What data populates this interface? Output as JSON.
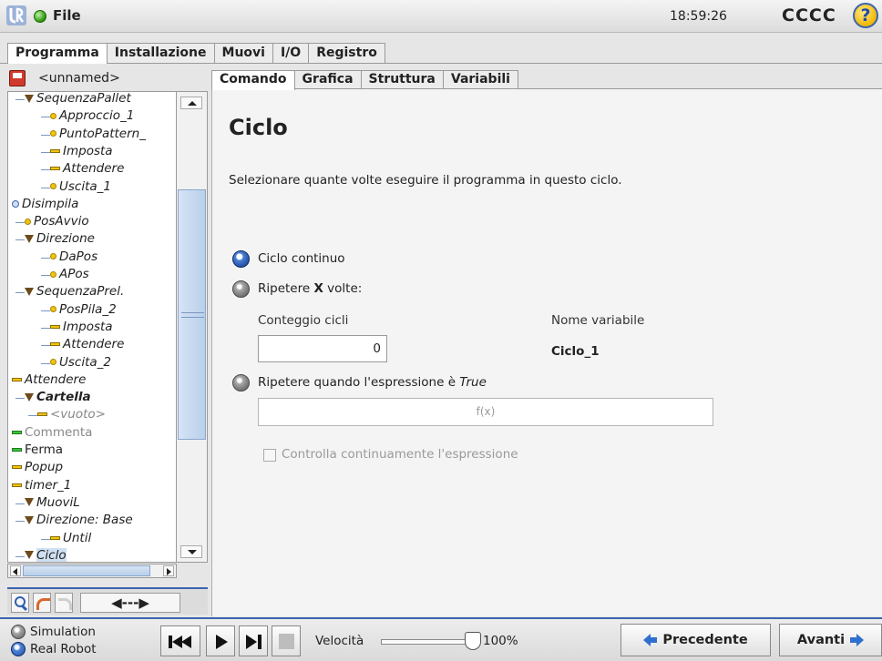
{
  "topbar": {
    "file_label": "File",
    "clock": "18:59:26",
    "robot_name": "CCCC",
    "help_label": "?"
  },
  "main_tabs": [
    {
      "label": "Programma",
      "active": true
    },
    {
      "label": "Installazione",
      "active": false
    },
    {
      "label": "Muovi",
      "active": false
    },
    {
      "label": "I/O",
      "active": false
    },
    {
      "label": "Registro",
      "active": false
    }
  ],
  "program": {
    "name": "<unnamed>"
  },
  "tree": [
    {
      "label": "SequenzaPallet",
      "icon": "folder-icon",
      "style": "italic"
    },
    {
      "label": "Approccio_1",
      "icon": "waypoint-icon",
      "style": "italic"
    },
    {
      "label": "PuntoPattern_",
      "icon": "waypoint-icon",
      "style": "italic"
    },
    {
      "label": "Imposta",
      "icon": "command-icon",
      "style": "italic"
    },
    {
      "label": "Attendere",
      "icon": "command-icon",
      "style": "italic"
    },
    {
      "label": "Uscita_1",
      "icon": "waypoint-icon",
      "style": "italic"
    },
    {
      "label": "Disimpila",
      "icon": "pallet-icon",
      "style": "italic"
    },
    {
      "label": "PosAvvio",
      "icon": "waypoint-icon",
      "style": "italic"
    },
    {
      "label": "Direzione",
      "icon": "folder-icon",
      "style": "italic"
    },
    {
      "label": "DaPos",
      "icon": "waypoint-icon",
      "style": "italic"
    },
    {
      "label": "APos",
      "icon": "waypoint-icon",
      "style": "italic"
    },
    {
      "label": "SequenzaPrel.",
      "icon": "folder-icon",
      "style": "italic"
    },
    {
      "label": "PosPila_2",
      "icon": "waypoint-icon",
      "style": "italic"
    },
    {
      "label": "Imposta",
      "icon": "command-icon",
      "style": "italic"
    },
    {
      "label": "Attendere",
      "icon": "command-icon",
      "style": "italic"
    },
    {
      "label": "Uscita_2",
      "icon": "waypoint-icon",
      "style": "italic"
    },
    {
      "label": "Attendere",
      "icon": "command-icon",
      "style": "italic"
    },
    {
      "label": "Cartella",
      "icon": "folder-icon",
      "style": "bold-italic"
    },
    {
      "label": "<vuoto>",
      "icon": "command-icon",
      "style": "grey-italic"
    },
    {
      "label": "Commenta",
      "icon": "comment-icon",
      "style": "grey"
    },
    {
      "label": "Ferma",
      "icon": "command-icon-green",
      "style": "normal"
    },
    {
      "label": "Popup",
      "icon": "command-icon",
      "style": "italic"
    },
    {
      "label": "timer_1",
      "icon": "command-icon",
      "style": "italic"
    },
    {
      "label": "MuoviL",
      "icon": "folder-icon",
      "style": "italic"
    },
    {
      "label": "Direzione: Base",
      "icon": "folder-icon",
      "style": "italic"
    },
    {
      "label": "Until",
      "icon": "command-icon",
      "style": "italic"
    },
    {
      "label": "Ciclo",
      "icon": "folder-icon",
      "style": "italic-selected"
    }
  ],
  "left_toolbar": {
    "move_label": "◀---▶"
  },
  "sub_tabs": [
    {
      "label": "Comando",
      "active": true
    },
    {
      "label": "Grafica",
      "active": false
    },
    {
      "label": "Struttura",
      "active": false
    },
    {
      "label": "Variabili",
      "active": false
    }
  ],
  "content": {
    "title": "Ciclo",
    "description": "Selezionare quante volte eseguire il programma in questo ciclo.",
    "option_continuous": "Ciclo continuo",
    "option_repeat_pre": "Ripetere ",
    "option_repeat_x": "X",
    "option_repeat_post": " volte:",
    "count_label": "Conteggio cicli",
    "count_value": "0",
    "varname_label": "Nome variabile",
    "varname_value": "Ciclo_1",
    "option_expr_pre": "Ripetere quando l'espressione è ",
    "option_expr_true": "True",
    "expr_placeholder": "f(x)",
    "check_label": "Controlla continuamente l'espressione",
    "selected_option": "continuous"
  },
  "bottombar": {
    "simulation_label": "Simulation",
    "real_robot_label": "Real Robot",
    "selected_mode": "Real Robot",
    "speed_label": "Velocità",
    "speed_value": "100%",
    "speed_fraction": 1.0,
    "prev_label": "Precedente",
    "next_label": "Avanti"
  },
  "colors": {
    "accent": "#3a64b0",
    "status_ok": "#2f9a12",
    "arrow": "#2f6fd0"
  }
}
